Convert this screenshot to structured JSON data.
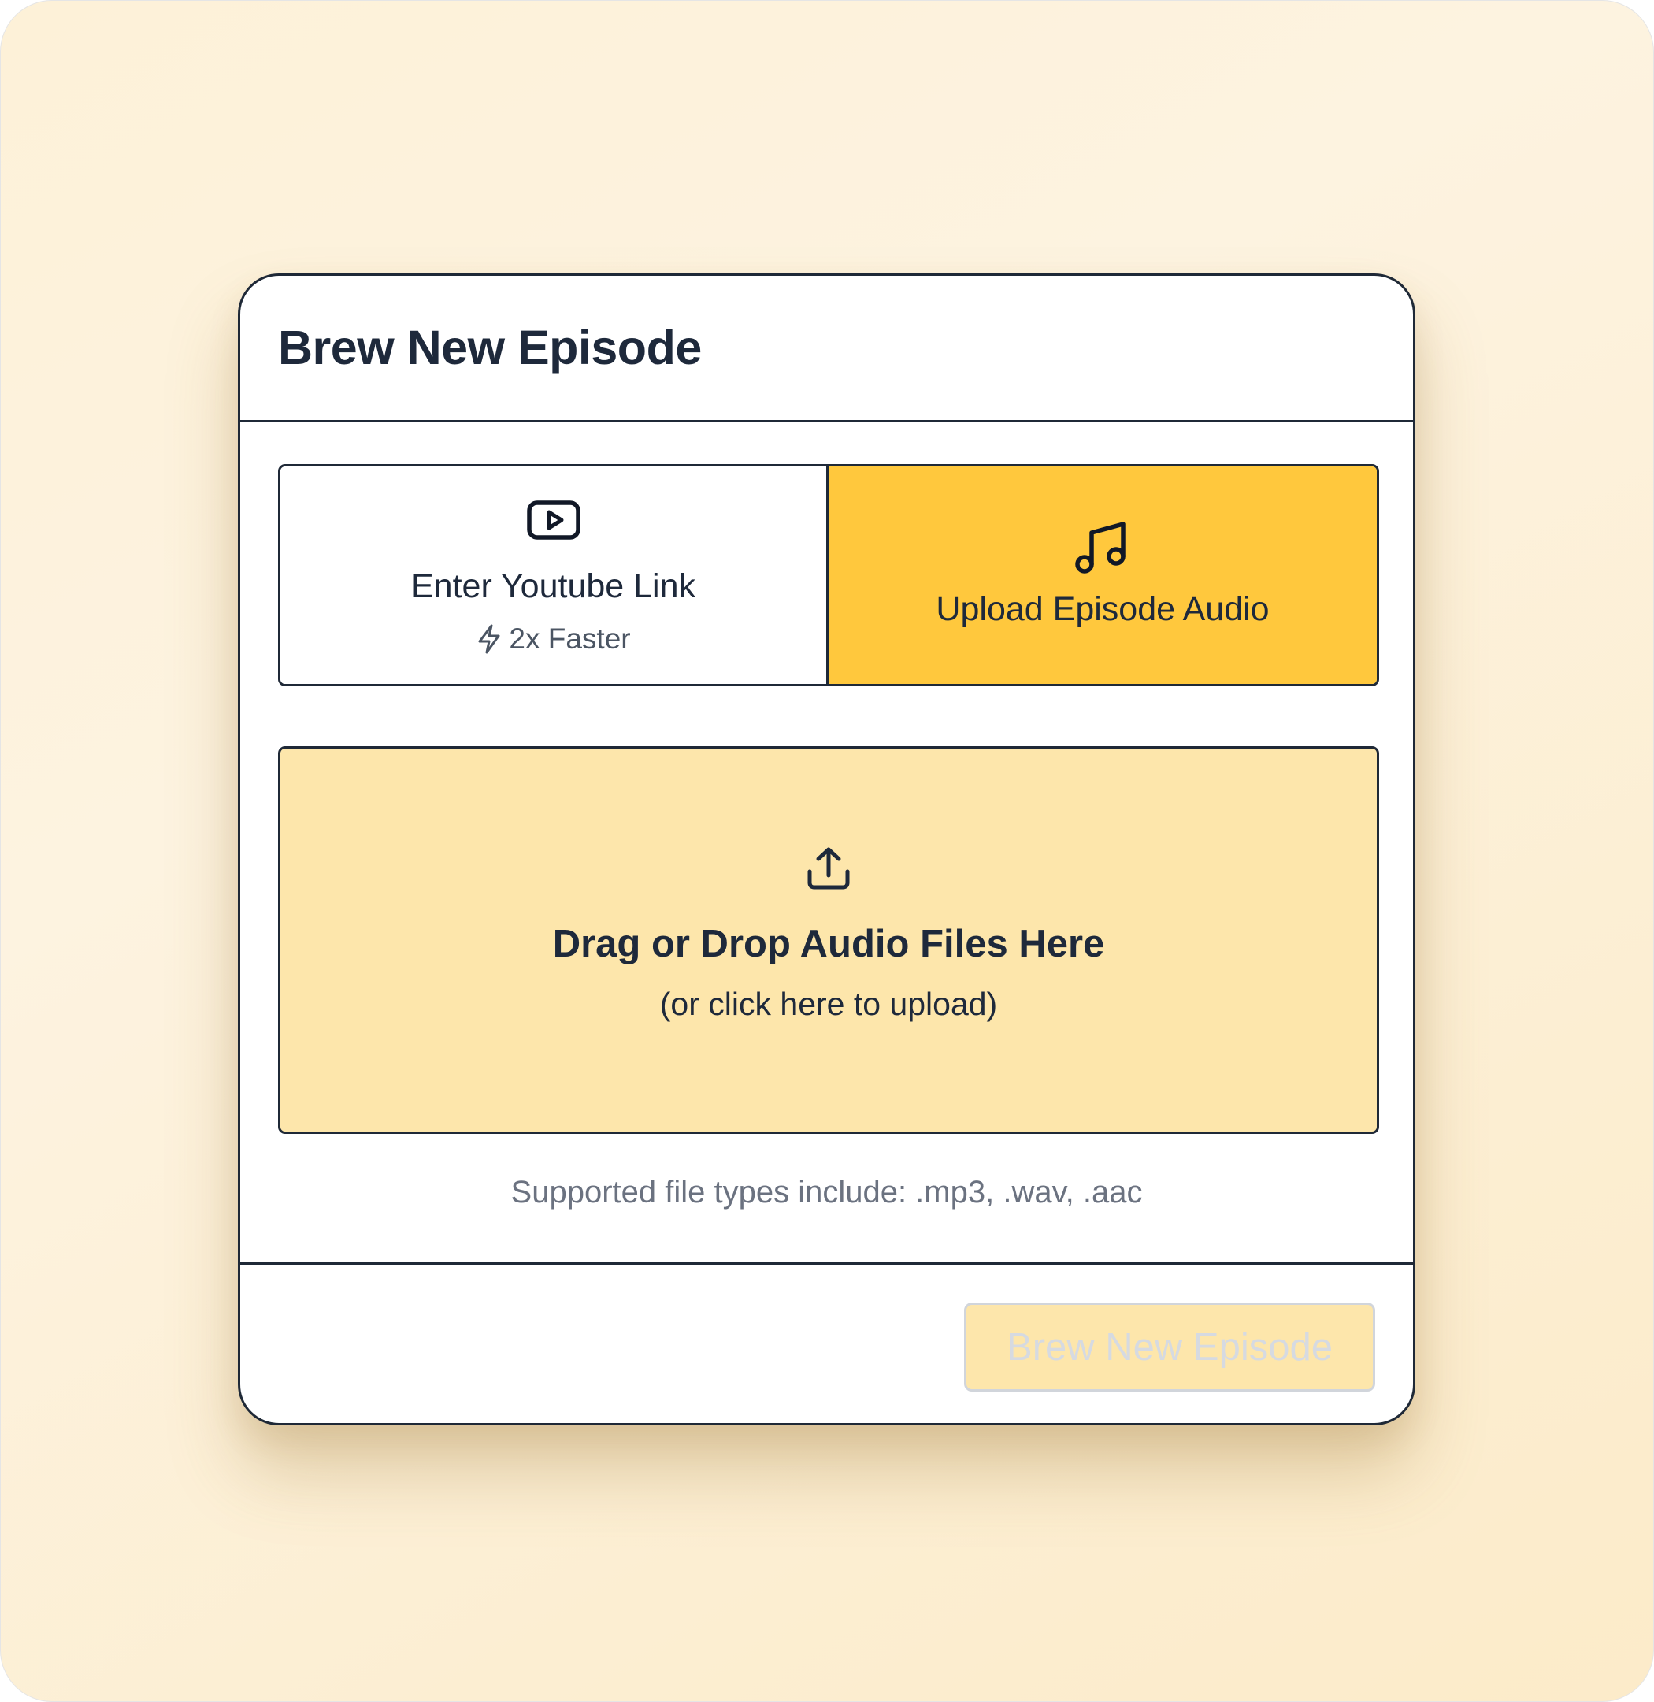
{
  "modal": {
    "title": "Brew New Episode"
  },
  "source_toggle": {
    "options": [
      {
        "id": "youtube",
        "label": "Enter Youtube Link",
        "sublabel": "2x Faster",
        "icon": "youtube-play-icon",
        "sublabel_icon": "lightning-bolt-icon",
        "selected": false
      },
      {
        "id": "upload",
        "label": "Upload Episode Audio",
        "icon": "music-note-icon",
        "selected": true
      }
    ]
  },
  "dropzone": {
    "icon": "upload-icon",
    "title": "Drag or Drop Audio Files Here",
    "subtitle": "(or click here to upload)"
  },
  "supported_note": "Supported file types include: .mp3, .wav, .aac",
  "footer": {
    "submit_label": "Brew New Episode",
    "submit_disabled": true
  },
  "colors": {
    "backdrop": "#fdf1d8",
    "accent_selected": "#ffc83d",
    "dropzone_fill": "#fde6ab",
    "border": "#1f2937",
    "text_primary": "#1e293b",
    "text_muted": "#6b7280"
  }
}
